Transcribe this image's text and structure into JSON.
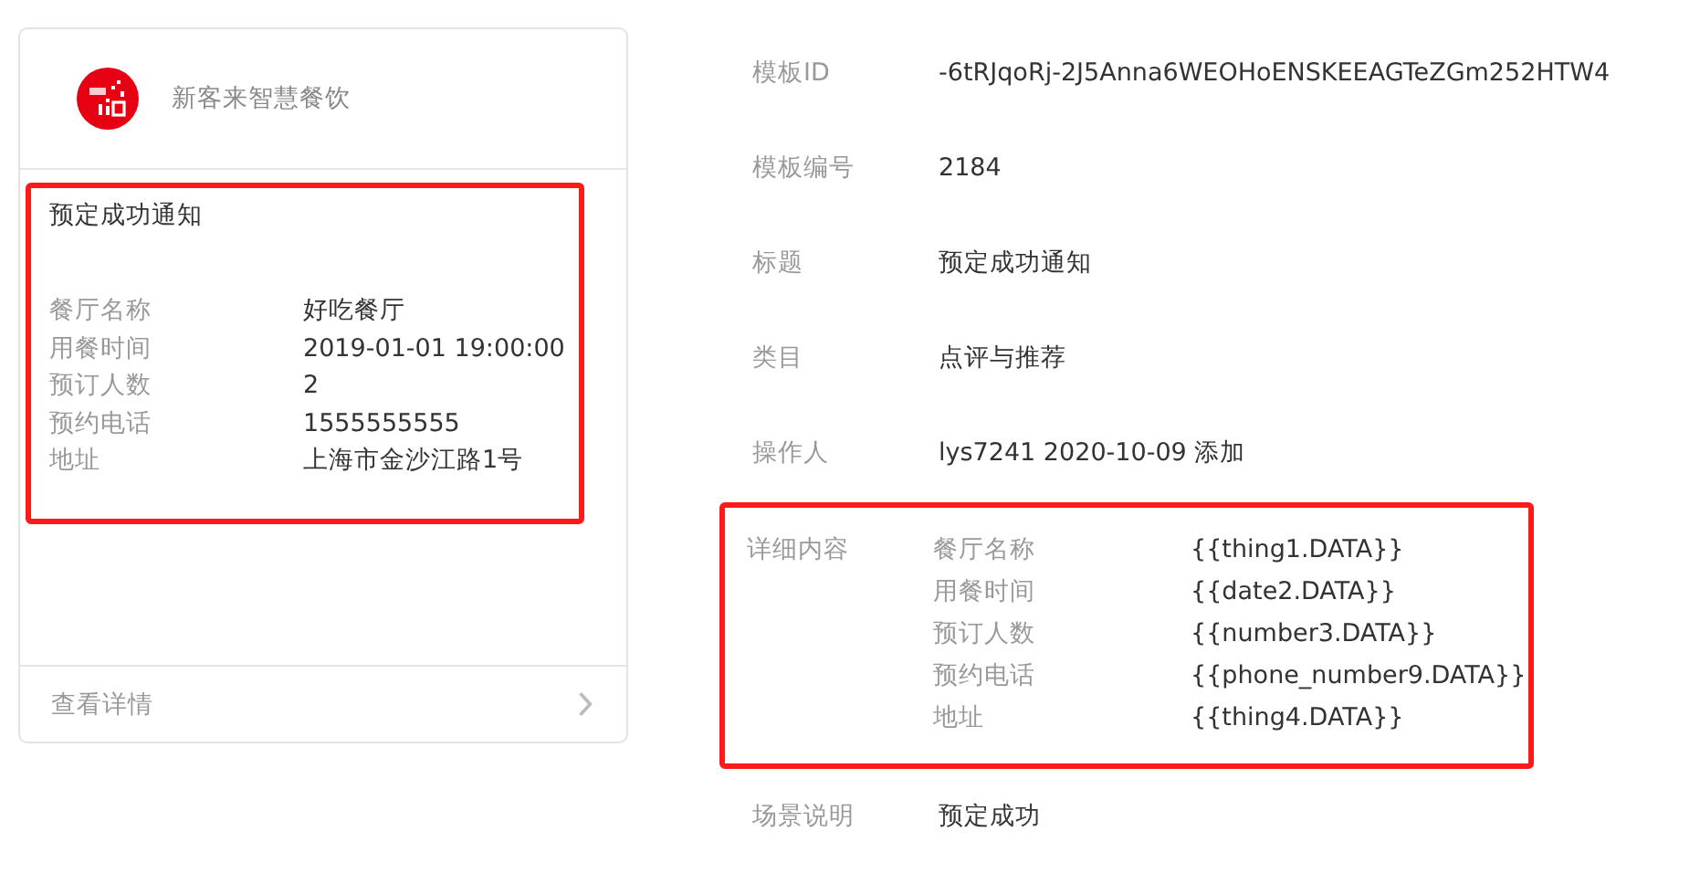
{
  "card": {
    "brand": "新客来智慧餐饮",
    "highlighted": true,
    "title": "预定成功通知",
    "fields": [
      {
        "label": "餐厅名称",
        "value": "好吃餐厅"
      },
      {
        "label": "用餐时间",
        "value": "2019-01-01 19:00:00"
      },
      {
        "label": "预订人数",
        "value": "2"
      },
      {
        "label": "预约电话",
        "value": "1555555555"
      },
      {
        "label": "地址",
        "value": "上海市金沙江路1号"
      }
    ],
    "footer_link": "查看详情"
  },
  "info": [
    {
      "label": "模板ID",
      "value": "-6tRJqoRj-2J5Anna6WEOHoENSKEEAGTeZGm252HTW4"
    },
    {
      "label": "模板编号",
      "value": "2184"
    },
    {
      "label": "标题",
      "value": "预定成功通知"
    },
    {
      "label": "类目",
      "value": "点评与推荐"
    },
    {
      "label": "操作人",
      "value": "lys7241 2020-10-09 添加"
    }
  ],
  "detail": {
    "label": "详细内容",
    "highlighted": true,
    "fields": [
      {
        "label": "餐厅名称",
        "value": "{{thing1.DATA}}"
      },
      {
        "label": "用餐时间",
        "value": "{{date2.DATA}}"
      },
      {
        "label": "预订人数",
        "value": "{{number3.DATA}}"
      },
      {
        "label": "预约电话",
        "value": "{{phone_number9.DATA}}"
      },
      {
        "label": "地址",
        "value": "{{thing4.DATA}}"
      }
    ]
  },
  "scene": {
    "label": "场景说明",
    "value": "预定成功"
  }
}
